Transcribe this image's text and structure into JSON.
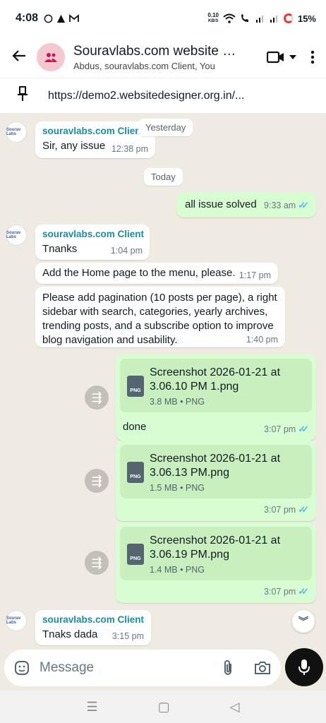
{
  "status_bar": {
    "time": "4:08",
    "net_speed_value": "0.10",
    "net_speed_unit": "KB/S",
    "battery": "15%"
  },
  "header": {
    "title": "Souravlabs.com website g...",
    "subtitle": "Abdus, souravlabs.com Client, You"
  },
  "pinned": {
    "url": "https://demo2.websitedesigner.org.in/..."
  },
  "chat": {
    "logo_text": "Sourav Labs",
    "date_yesterday": "Yesterday",
    "date_today": "Today",
    "messages": [
      {
        "sender": "souravlabs.com Client",
        "text": "Sir, any issue",
        "time": "12:38 pm"
      },
      {
        "text": "all issue solved",
        "time": "9:33 am"
      },
      {
        "sender": "souravlabs.com Client",
        "text": "Tnanks",
        "time": "1:04 pm"
      },
      {
        "text": "Add the Home page to the menu, please.",
        "time": "1:17 pm"
      },
      {
        "text": "Please add pagination (10 posts per page), a right sidebar with search, categories, yearly archives, trending posts, and a subscribe option to improve blog navigation and usability.",
        "time": "1:40 pm"
      },
      {
        "file_name": "Screenshot 2026-01-21 at 3.06.10 PM 1.png",
        "file_info": "3.8 MB • PNG",
        "caption": "done",
        "time": "3:07 pm"
      },
      {
        "file_name": "Screenshot 2026-01-21 at 3.06.13 PM.png",
        "file_info": "1.5 MB • PNG",
        "time": "3:07 pm"
      },
      {
        "file_name": "Screenshot 2026-01-21 at 3.06.19 PM.png",
        "file_info": "1.4 MB • PNG",
        "time": "3:07 pm"
      },
      {
        "sender": "souravlabs.com Client",
        "text": "Tnaks dada",
        "time": "3:15 pm"
      }
    ],
    "file_badge": "PNG"
  },
  "composer": {
    "placeholder": "Message"
  },
  "colors": {
    "outgoing_bubble": "#d9fdd3",
    "incoming_bubble": "#ffffff",
    "chat_background": "#efeae2",
    "sender_name": "#1a8da6",
    "read_ticks": "#53bdeb"
  }
}
